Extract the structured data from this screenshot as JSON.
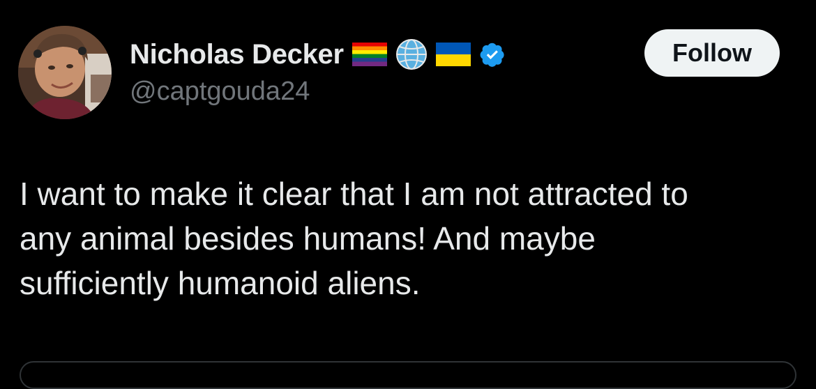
{
  "author": {
    "display_name": "Nicholas Decker",
    "handle": "@captgouda24",
    "badges": [
      "rainbow-flag-icon",
      "globe-icon",
      "ukraine-flag-icon",
      "verified-badge-icon"
    ],
    "verified_color": "#1d9bf0"
  },
  "actions": {
    "follow_label": "Follow"
  },
  "tweet": {
    "text": "I want to make it clear that I am not attracted to\nany animal besides humans! And maybe\nsufficiently humanoid aliens."
  },
  "colors": {
    "background": "#000000",
    "primary_text": "#e7e9ea",
    "secondary_text": "#71767b",
    "follow_bg": "#eff3f4"
  }
}
